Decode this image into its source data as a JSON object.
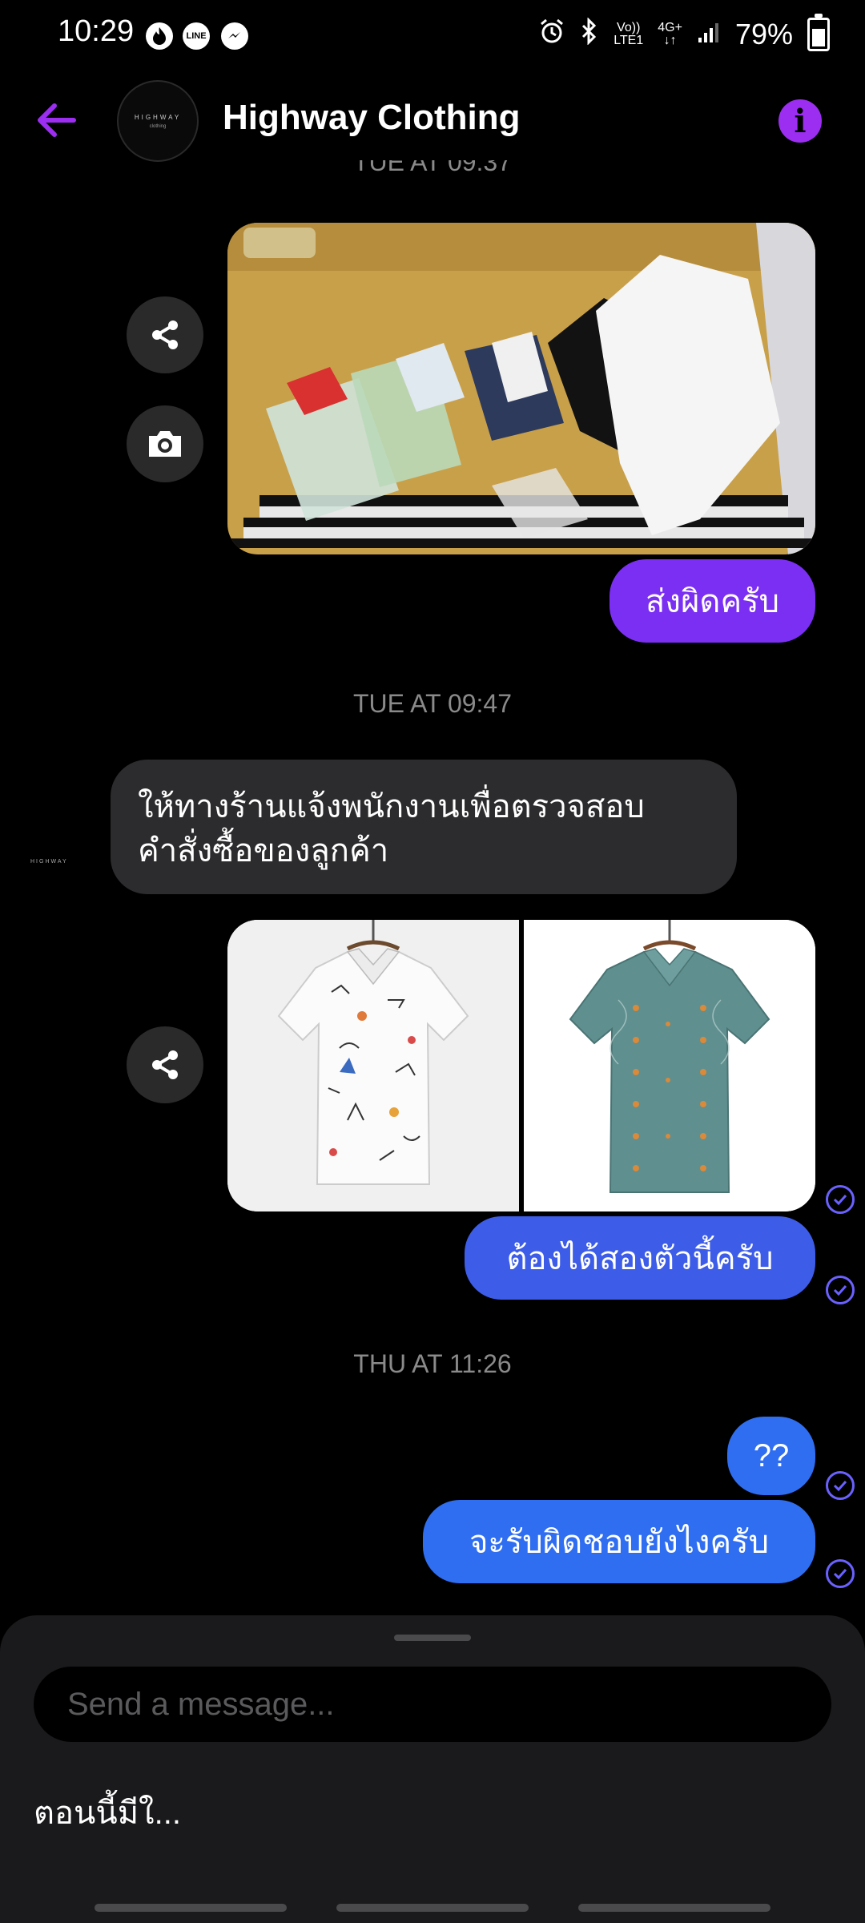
{
  "status_bar": {
    "time": "10:29",
    "left_icons": [
      "flame-icon",
      "line-app-icon",
      "messenger-icon"
    ],
    "network_top": "Vo))",
    "network_bottom": "LTE1",
    "data_type": "4G+",
    "battery": "79%"
  },
  "header": {
    "title": "Highway Clothing",
    "avatar_logo": "HIGHWAY",
    "avatar_sub": "clothing",
    "accent_color": "#9b2ef0"
  },
  "messages": {
    "cut_timestamp": "TUE AT 09:37",
    "msg_1": "ส่งผิดครับ",
    "timestamp_2": "TUE AT 09:47",
    "msg_2_line1": "ให้ทางร้านแจ้งพนักงานเพื่อตรวจสอบ",
    "msg_2_line2": "คำสั่งซื้อของลูกค้า",
    "sender_logo": "HIGHWAY",
    "msg_3": "ต้องได้สองตัวนี้ครับ",
    "timestamp_3": "THU AT 11:26",
    "msg_4": "??",
    "msg_5": "จะรับผิดชอบยังไงครับ"
  },
  "composer": {
    "placeholder": "Send a message...",
    "suggestion": "ตอนนี้มีใ..."
  },
  "colors": {
    "purple_bubble": "#7b2ff2",
    "blue_bubble": "#3d5de8",
    "gray_bubble": "#2c2c2e",
    "timestamp": "#8a8a8a"
  }
}
